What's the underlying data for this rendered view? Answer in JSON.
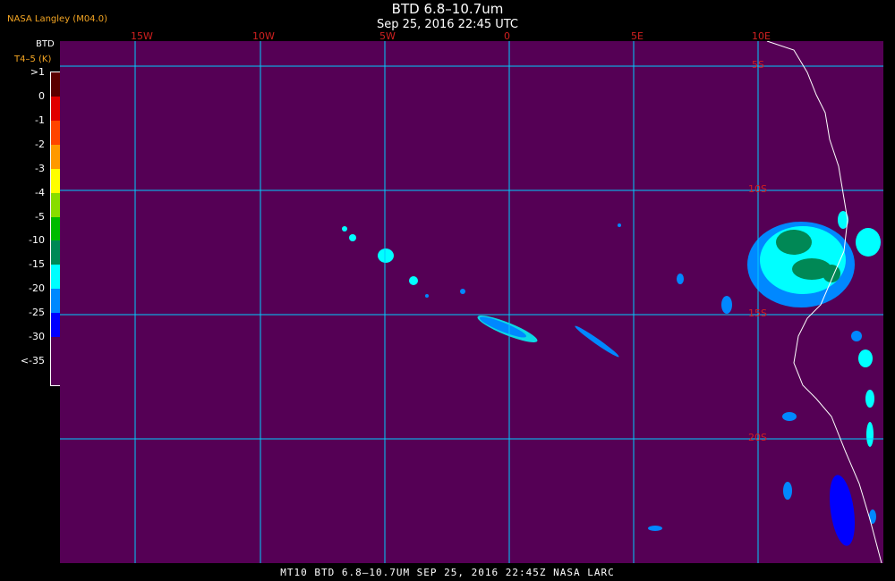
{
  "header": {
    "title": "BTD 6.8–10.7um",
    "subtitle": "Sep 25, 2016 22:45 UTC",
    "org_label": "NASA Langley (M04.0)"
  },
  "legend": {
    "title": "BTD",
    "subtitle": "T4–5 (K)",
    "entries": [
      {
        "label": ">1",
        "color": "#5a0000"
      },
      {
        "label": "0",
        "color": "#e00000"
      },
      {
        "label": "-1",
        "color": "#ff4400"
      },
      {
        "label": "-2",
        "color": "#ff9900"
      },
      {
        "label": "-3",
        "color": "#ffff00"
      },
      {
        "label": "-4",
        "color": "#88dd00"
      },
      {
        "label": "-5",
        "color": "#00bb00"
      },
      {
        "label": "-10",
        "color": "#008855"
      },
      {
        "label": "-15",
        "color": "#00ffff"
      },
      {
        "label": "-20",
        "color": "#0088ff"
      },
      {
        "label": "-25",
        "color": "#0000ff"
      },
      {
        "label": "-30",
        "color": "#550055"
      },
      {
        "label": "<-35",
        "color": ""
      }
    ]
  },
  "map": {
    "background_color": "#550055",
    "grid_color": "#00ccff",
    "coast_color": "#ffffff",
    "lon_labels": [
      "15W",
      "10W",
      "5W",
      "0",
      "5E",
      "10E"
    ],
    "lat_labels": [
      "5S",
      "10S",
      "15S",
      "20S"
    ]
  },
  "footer": "MT10  BTD 6.8–10.7UM  SEP 25, 2016 22:45Z  NASA LARC"
}
